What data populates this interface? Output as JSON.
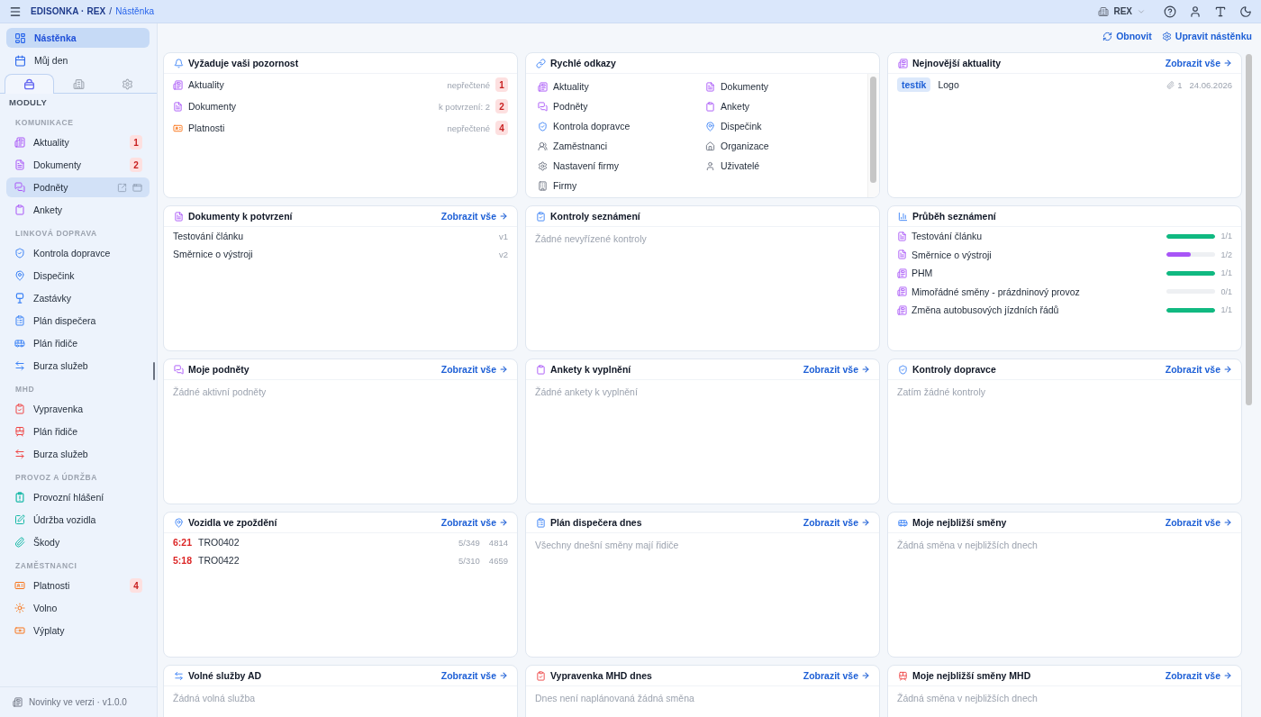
{
  "topbar": {
    "app": "EDISONKA · REX",
    "separator": "/",
    "page": "Nástěnka",
    "organization": "REX"
  },
  "sidebar": {
    "nav": [
      {
        "label": "Nástěnka",
        "kind": "dashboard",
        "selected": true
      },
      {
        "label": "Můj den",
        "kind": "calendar",
        "selected": false
      }
    ],
    "tabs": [
      {
        "kind": "modules",
        "selected": true
      },
      {
        "kind": "company",
        "selected": false
      },
      {
        "kind": "settings",
        "selected": false
      }
    ],
    "heading": "MODULY",
    "sections": [
      {
        "title": "KOMUNIKACE",
        "items": [
          {
            "label": "Aktuality",
            "kind": "news",
            "badge": "1",
            "hovered": false
          },
          {
            "label": "Dokumenty",
            "kind": "document",
            "badge": "2",
            "hovered": false
          },
          {
            "label": "Podněty",
            "kind": "ideas",
            "hovered": true
          },
          {
            "label": "Ankety",
            "kind": "survey",
            "hovered": false
          }
        ]
      },
      {
        "title": "LINKOVÁ DOPRAVA",
        "items": [
          {
            "label": "Kontrola dopravce",
            "kind": "carrier",
            "hovered": false
          },
          {
            "label": "Dispečink",
            "kind": "dispatch",
            "hovered": false
          },
          {
            "label": "Zastávky",
            "kind": "stops",
            "hovered": false
          },
          {
            "label": "Plán dispečera",
            "kind": "dispatchplan",
            "hovered": false
          },
          {
            "label": "Plán řidiče",
            "kind": "driverplan",
            "hovered": false
          },
          {
            "label": "Burza služeb",
            "kind": "exchange",
            "hovered": false
          }
        ]
      },
      {
        "title": "MHD",
        "items": [
          {
            "label": "Vypravenka",
            "kind": "departures",
            "hovered": false
          },
          {
            "label": "Plán řidiče",
            "kind": "tramplan",
            "hovered": false
          },
          {
            "label": "Burza služeb",
            "kind": "mhdexchange",
            "hovered": false
          }
        ]
      },
      {
        "title": "PROVOZ A ÚDRŽBA",
        "items": [
          {
            "label": "Provozní hlášení",
            "kind": "report",
            "hovered": false
          },
          {
            "label": "Údržba vozidla",
            "kind": "maintenance",
            "hovered": false
          },
          {
            "label": "Škody",
            "kind": "damage",
            "hovered": false
          }
        ]
      },
      {
        "title": "ZAMĚSTNANCI",
        "items": [
          {
            "label": "Platnosti",
            "kind": "validity",
            "badge": "4",
            "hovered": false
          },
          {
            "label": "Volno",
            "kind": "leave",
            "hovered": false
          },
          {
            "label": "Výplaty",
            "kind": "pay",
            "hovered": false
          }
        ]
      }
    ],
    "footer": "Novinky ve verzi · v1.0.0"
  },
  "actions": [
    {
      "label": "Obnovit",
      "kind": "refresh"
    },
    {
      "label": "Upravit nástěnku",
      "kind": "edit"
    }
  ],
  "cards": [
    {
      "title": "Vyžaduje vaši pozornost",
      "kind": "attention",
      "rows": [
        {
          "label": "Aktuality",
          "kind": "news",
          "note": "nepřečtené",
          "count": "1"
        },
        {
          "label": "Dokumenty",
          "kind": "document",
          "note": "k potvrzení: 2",
          "count": "2"
        },
        {
          "label": "Platnosti",
          "kind": "validity",
          "note": "nepřečtené",
          "count": "4"
        }
      ]
    },
    {
      "title": "Rychlé odkazy",
      "kind": "links",
      "links": [
        {
          "label": "Aktuality",
          "kind": "news"
        },
        {
          "label": "Dokumenty",
          "kind": "document"
        },
        {
          "label": "Podněty",
          "kind": "ideas"
        },
        {
          "label": "Ankety",
          "kind": "survey"
        },
        {
          "label": "Kontrola dopravce",
          "kind": "carrier"
        },
        {
          "label": "Dispečink",
          "kind": "dispatch"
        },
        {
          "label": "Zaměstnanci",
          "kind": "employees"
        },
        {
          "label": "Organizace",
          "kind": "organization"
        },
        {
          "label": "Nastavení firmy",
          "kind": "companysettings"
        },
        {
          "label": "Uživatelé",
          "kind": "users"
        },
        {
          "label": "Firmy",
          "kind": "companies"
        }
      ]
    },
    {
      "title": "Nejnovější aktuality",
      "kind": "news",
      "link": "Zobrazit vše",
      "items": [
        {
          "tag": "testík",
          "title": "Logo",
          "attachments": "1",
          "date": "24.06.2026"
        }
      ]
    },
    {
      "title": "Dokumenty k potvrzení",
      "kind": "document",
      "link": "Zobrazit vše",
      "documents": [
        {
          "title": "Testování článku",
          "version": "v1"
        },
        {
          "title": "Směrnice o výstroji",
          "version": "v2"
        }
      ]
    },
    {
      "title": "Kontroly seznámení",
      "kind": "checks",
      "empty": "Žádné nevyřízené kontroly"
    },
    {
      "title": "Průběh seznámení",
      "kind": "progress",
      "progress": [
        {
          "label": "Testování článku",
          "kind": "document",
          "level": 1,
          "reading": "1/1"
        },
        {
          "label": "Směrnice o výstroji",
          "kind": "document",
          "level": 0.5,
          "reading": "1/2"
        },
        {
          "label": "PHM",
          "kind": "news",
          "level": 1,
          "reading": "1/1"
        },
        {
          "label": "Mimořádné směny - prázdninový provoz",
          "kind": "news",
          "level": 0,
          "reading": "0/1"
        },
        {
          "label": "Změna autobusových jízdních řádů",
          "kind": "news",
          "level": 1,
          "reading": "1/1"
        }
      ]
    },
    {
      "title": "Moje podněty",
      "kind": "ideas",
      "link": "Zobrazit vše",
      "empty": "Žádné aktivní podněty"
    },
    {
      "title": "Ankety k vyplnění",
      "kind": "survey",
      "link": "Zobrazit vše",
      "empty": "Žádné ankety k vyplnění"
    },
    {
      "title": "Kontroly dopravce",
      "kind": "carrier",
      "link": "Zobrazit vše",
      "empty": "Zatím žádné kontroly"
    },
    {
      "title": "Vozidla ve zpoždění",
      "kind": "delays",
      "link": "Zobrazit vše",
      "vehicles": [
        {
          "delay": "6:21",
          "vehicle": "TRO0402",
          "line": "5/349",
          "number": "4814"
        },
        {
          "delay": "5:18",
          "vehicle": "TRO0422",
          "line": "5/310",
          "number": "4659"
        }
      ]
    },
    {
      "title": "Plán dispečera dnes",
      "kind": "dispatchplan",
      "link": "Zobrazit vše",
      "empty": "Všechny dnešní směny mají řidiče"
    },
    {
      "title": "Moje nejbližší směny",
      "kind": "driverplan",
      "link": "Zobrazit vše",
      "empty": "Žádná směna v nejbližších dnech"
    },
    {
      "title": "Volné služby AD",
      "kind": "exchange",
      "link": "Zobrazit vše",
      "empty": "Žádná volná služba"
    },
    {
      "title": "Vypravenka MHD dnes",
      "kind": "departures",
      "link": "Zobrazit vše",
      "empty": "Dnes není naplánovaná žádná směna"
    },
    {
      "title": "Moje nejbližší směny MHD",
      "kind": "tramplan",
      "link": "Zobrazit vše",
      "empty": "Žádná směna v nejbližších dnech"
    }
  ]
}
